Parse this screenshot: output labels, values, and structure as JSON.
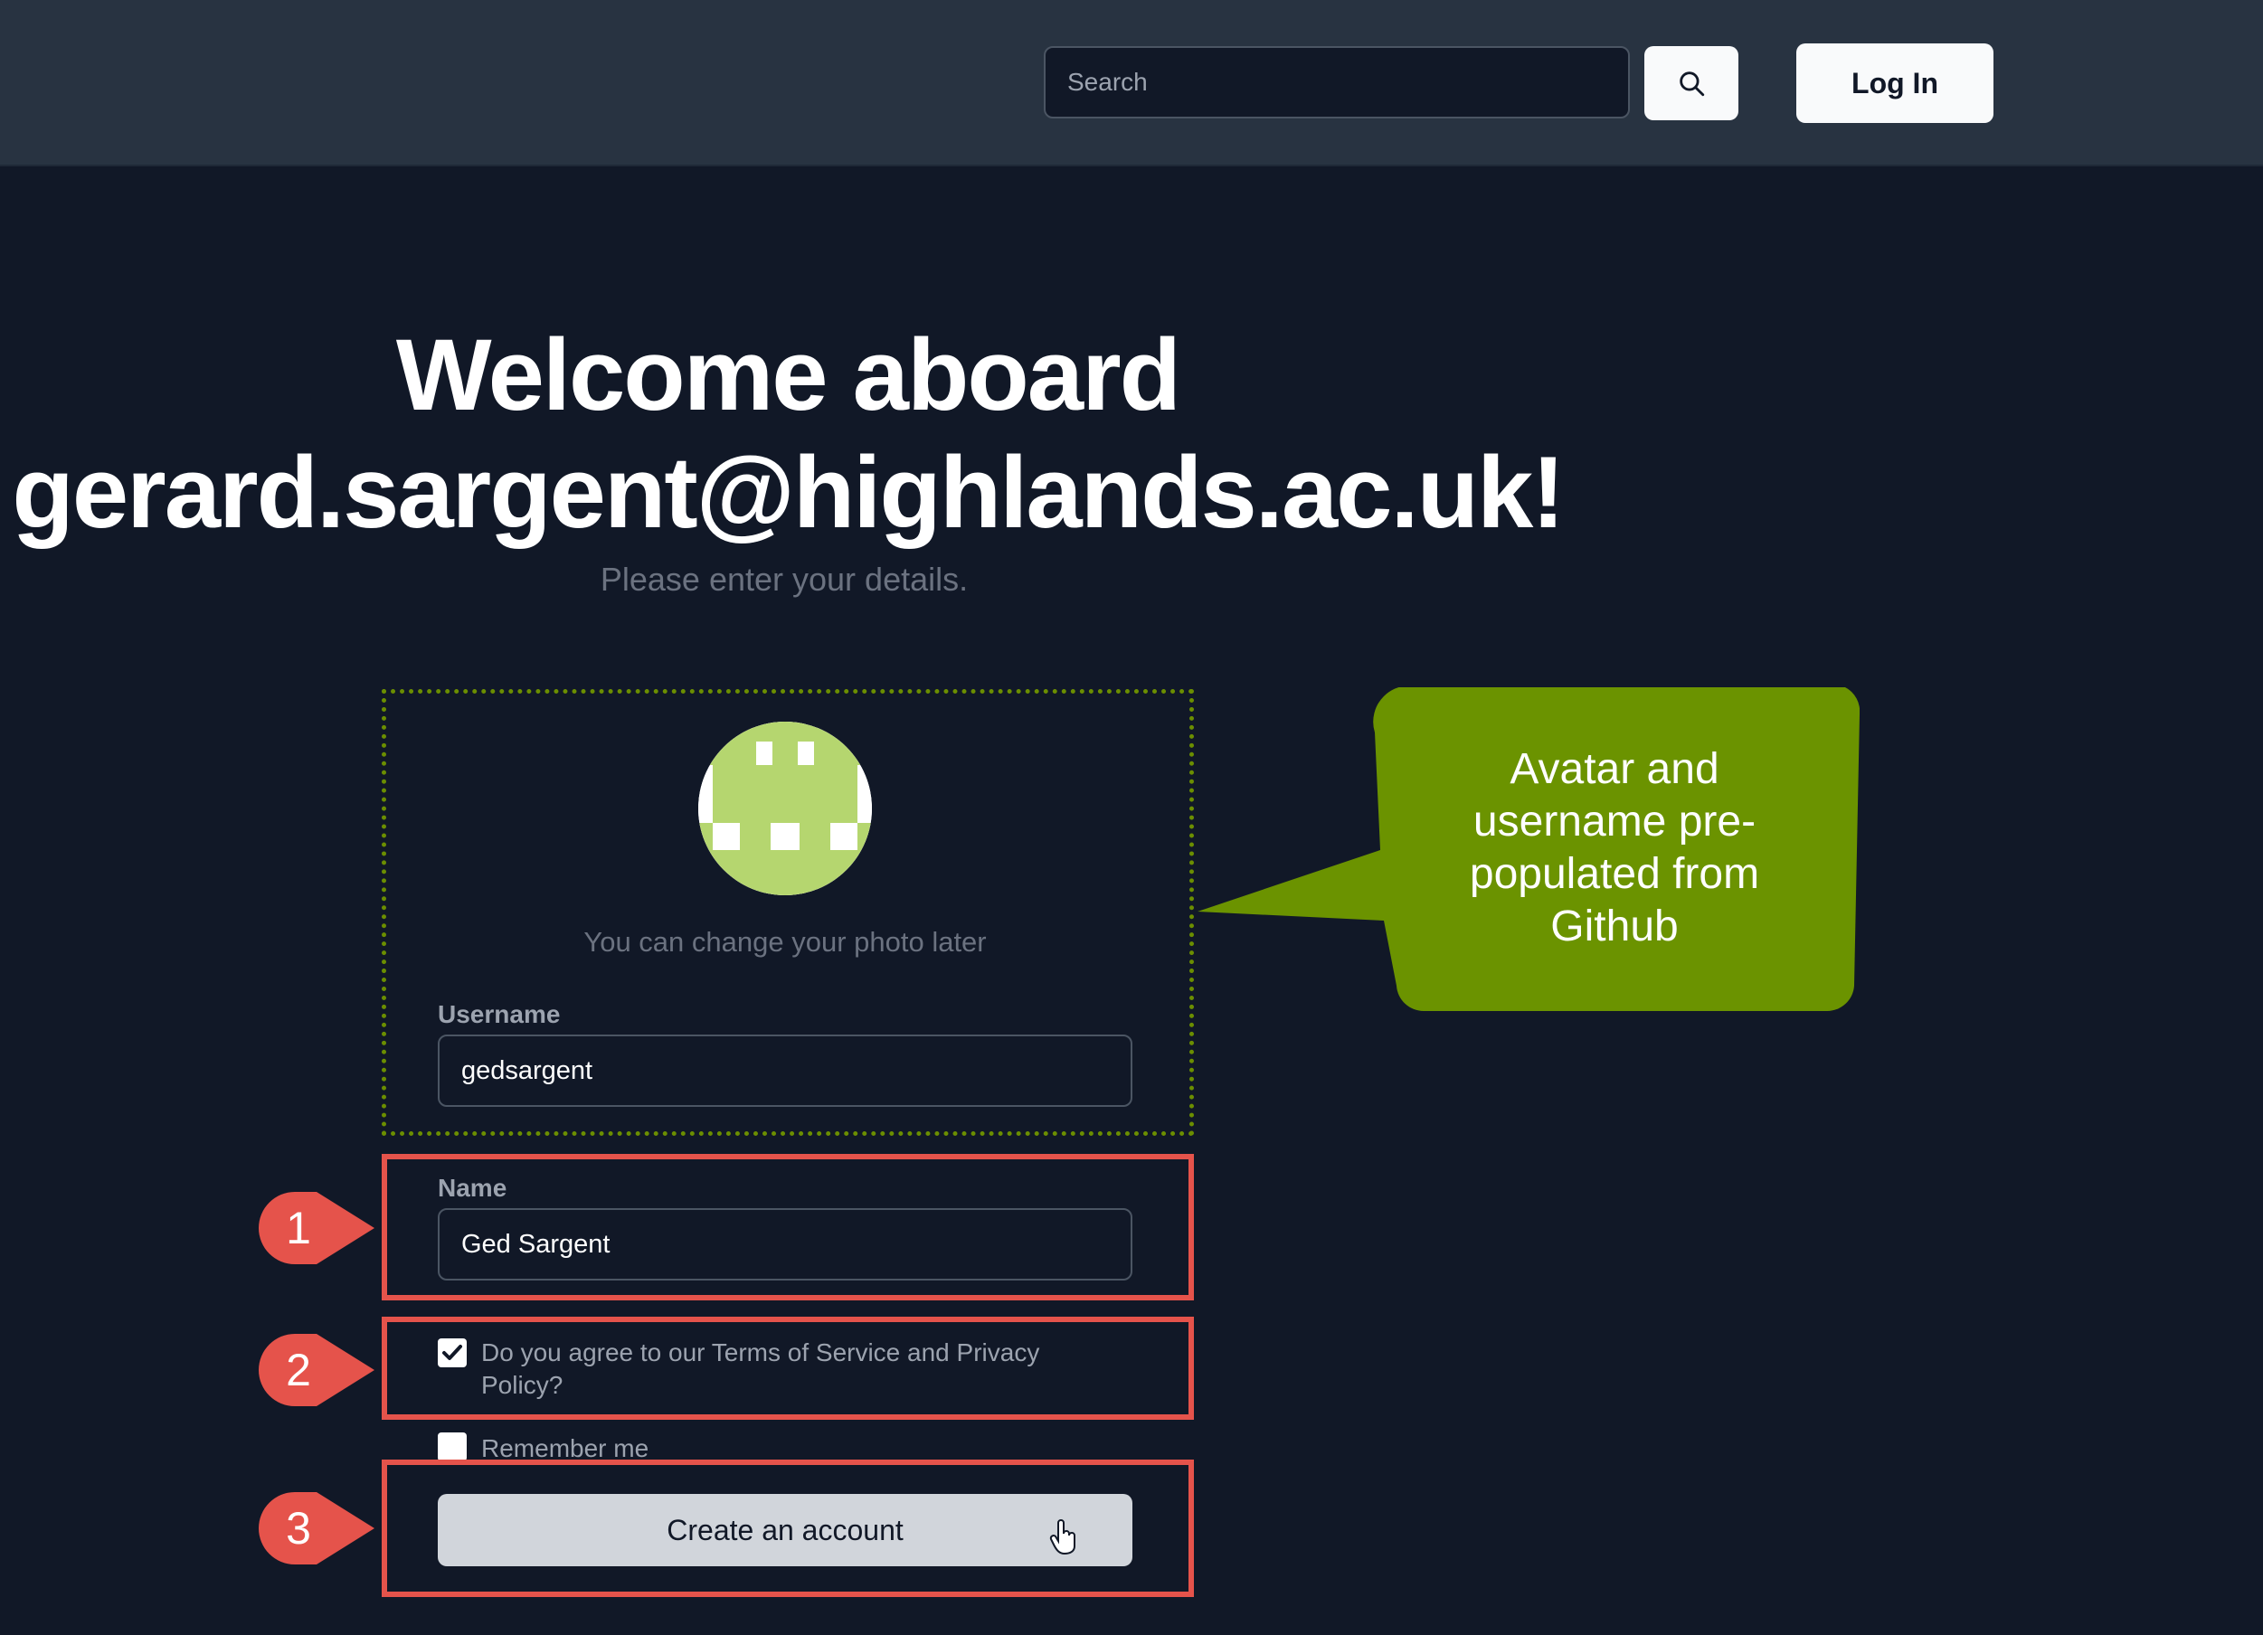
{
  "header": {
    "search_placeholder": "Search",
    "search_icon": "search-icon",
    "login_label": "Log In"
  },
  "main": {
    "title_line1": "Welcome aboard",
    "title_line2": "gerard.sargent@highlands.ac.uk!",
    "subtitle": "Please enter your details.",
    "photo_hint": "You can change your photo later",
    "username_label": "Username",
    "username_value": "gedsargent",
    "name_label": "Name",
    "name_value": "Ged Sargent",
    "terms_label": "Do you agree to our Terms of Service and Privacy Policy?",
    "terms_checked": true,
    "remember_label": "Remember me",
    "remember_checked": false,
    "create_label": "Create an account"
  },
  "annotations": {
    "callout_text": "Avatar and username pre-populated from Github",
    "markers": [
      "1",
      "2",
      "3"
    ],
    "callout_color": "#6b9300",
    "marker_color": "#e5534b"
  },
  "colors": {
    "background": "#111827",
    "topbar": "#283341",
    "avatar_green": "#b5d66f"
  }
}
